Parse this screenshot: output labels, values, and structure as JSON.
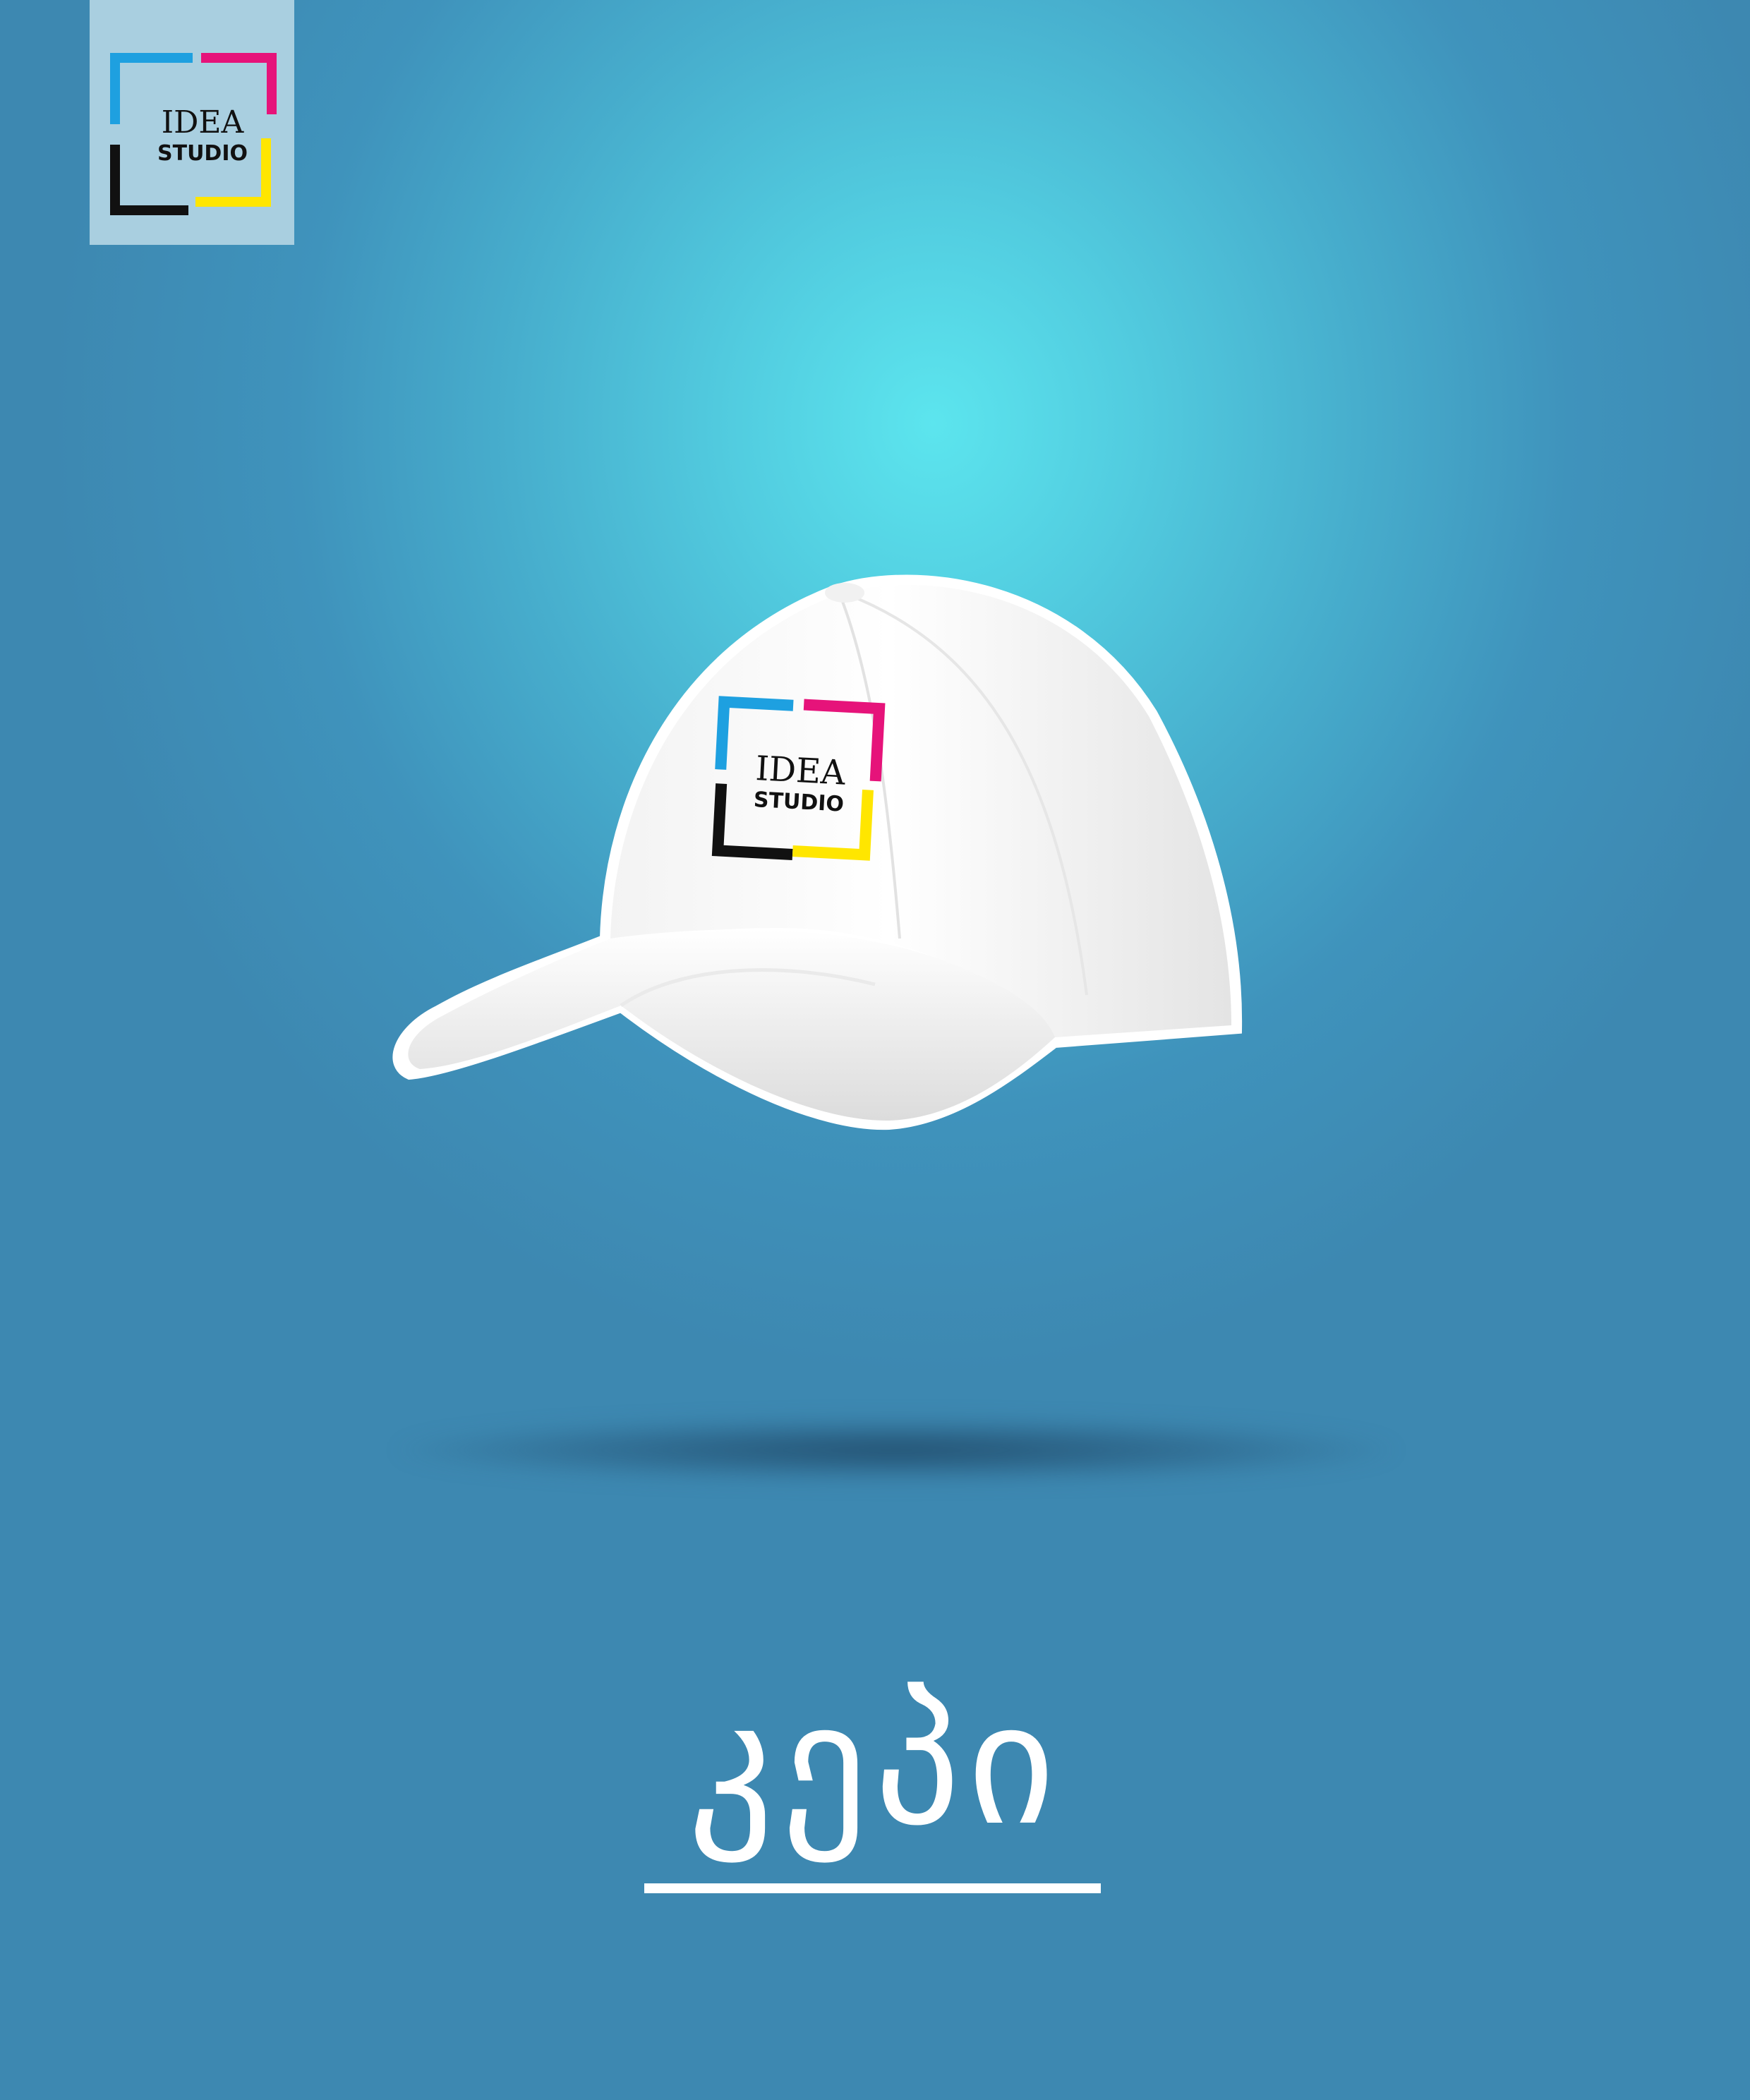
{
  "brand": {
    "line1": "IDEA",
    "line2": "STUDIO",
    "colors": {
      "cyan": "#1ea0e0",
      "magenta": "#e6137a",
      "yellow": "#ffe600",
      "black": "#111111"
    }
  },
  "product": {
    "title": "კეპი",
    "image": "white-baseball-cap-icon"
  },
  "background": {
    "center": "#5ce5ee",
    "edge": "#3d88b1"
  }
}
